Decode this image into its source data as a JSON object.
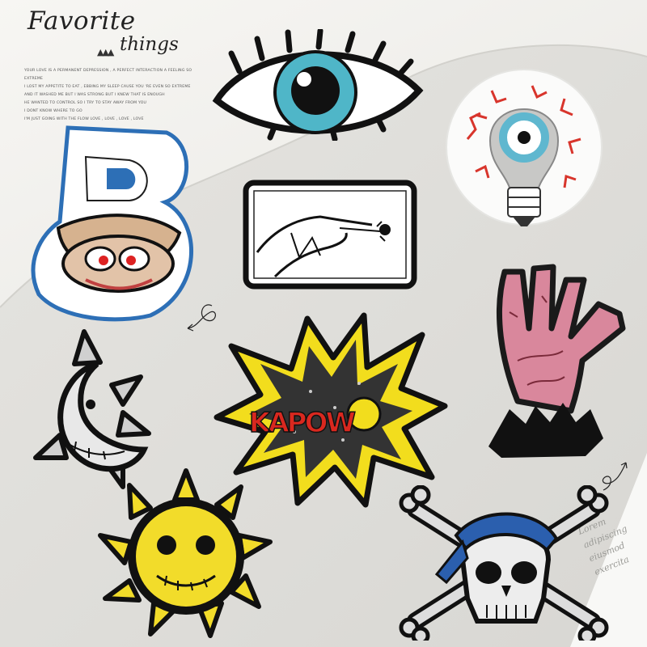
{
  "heading": {
    "title": "Favorite",
    "subtitle": "things",
    "triangles": "▲▲▲"
  },
  "blurb": {
    "lines": [
      "YOUR LOVE IS A PERMANENT DEPRESSION , A PERFECT INTERACTION A FEELING SO EXTREME",
      "I LOST MY APPETITE TO EAT , EBBING MY SLEEP CAUSE YOU 'RE EVEN SO EXTREME",
      "AND IT WASHED ME BUT I WAS STRONG BUT I KNEW THAT IS ENOUGH",
      "HE WANTED TO CONTROL SO I TRY TO STAY AWAY FROM YOU",
      "I DONT KNOW WHERE TO GO",
      "I'M JUST GOING WITH THE FLOW LOVE , LOVE , LOVE , LOVE"
    ]
  },
  "paper_text": {
    "lines": [
      "Lorem",
      "adipiscing",
      "eiusmod",
      "exercita"
    ]
  },
  "patches": [
    {
      "name": "eye-patch",
      "kind": "eye",
      "colors": [
        "#4fb6c8",
        "#111111"
      ]
    },
    {
      "name": "lightbulb-eyeball-patch",
      "kind": "lightbulb eyeball",
      "colors": [
        "#d8352c",
        "#5fb7cf"
      ]
    },
    {
      "name": "letter-b-oyster-patch",
      "kind": "letter B oyster",
      "colors": [
        "#2d6fb6",
        "#d6b28f"
      ]
    },
    {
      "name": "hand-rose-patch",
      "kind": "hand with rose",
      "colors": [
        "#ffffff",
        "#111111"
      ]
    },
    {
      "name": "zombie-hand-patch",
      "kind": "zombie hand",
      "colors": [
        "#d9879c",
        "#1a1a1a"
      ]
    },
    {
      "name": "spiked-moon-patch",
      "kind": "spiked moon",
      "colors": [
        "#d0d0d0",
        "#111111"
      ]
    },
    {
      "name": "kapow-patch",
      "kind": "comic burst",
      "colors": [
        "#f2dd1d",
        "#d9281f"
      ]
    },
    {
      "name": "sun-skull-patch",
      "kind": "spiked sun",
      "colors": [
        "#f2dc2a",
        "#111111"
      ]
    },
    {
      "name": "pirate-skull-patch",
      "kind": "pirate skull and crossbones",
      "colors": [
        "#2b5fae",
        "#dddddd"
      ]
    }
  ],
  "patch_text": {
    "kapow": "KAPOW"
  }
}
